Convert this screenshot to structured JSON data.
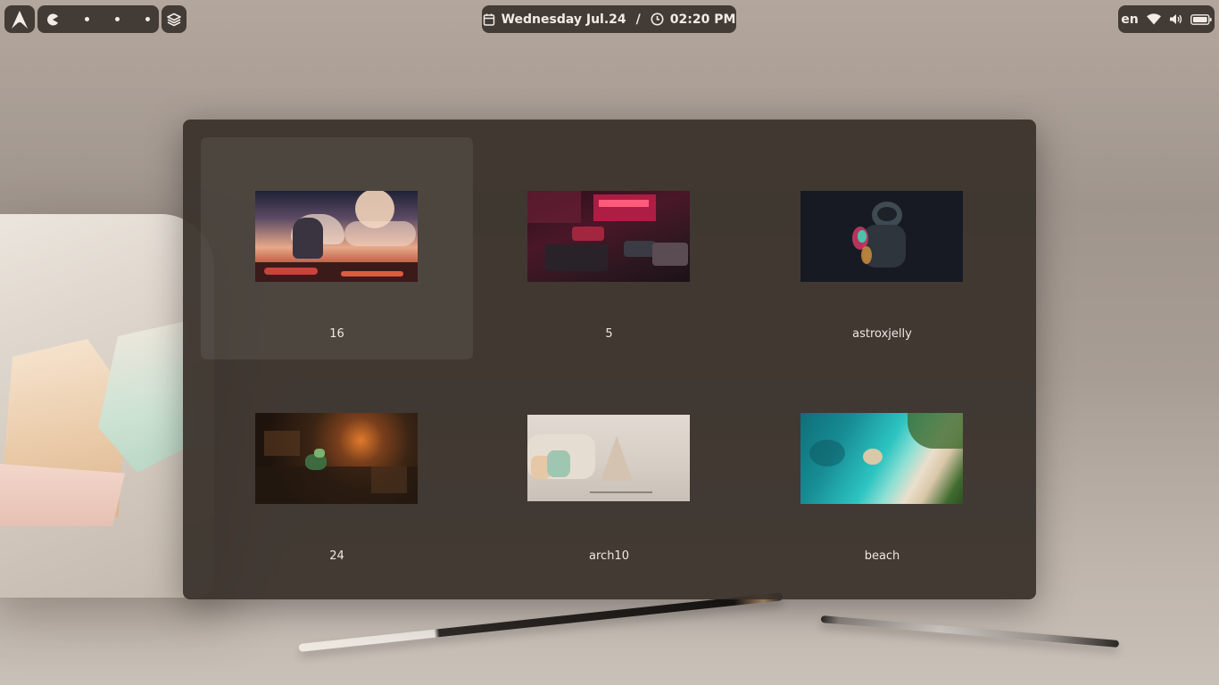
{
  "topbar": {
    "launcher_icon": "arch-logo-icon",
    "workspaces": [
      {
        "icon": "pacman-icon",
        "active": true
      },
      {
        "icon": "dot-icon",
        "active": false
      },
      {
        "icon": "dot-icon",
        "active": false
      },
      {
        "icon": "dot-icon",
        "active": false
      }
    ],
    "layers_icon": "layers-icon",
    "date": "Wednesday Jul.24",
    "separator": "/",
    "time": "02:20 PM",
    "language": "en",
    "tray_icons": [
      "wifi-icon",
      "volume-icon",
      "battery-icon"
    ]
  },
  "wallpaper_picker": {
    "selected_index": 0,
    "items": [
      {
        "name": "16",
        "palette": [
          "#1f2236",
          "#e7a88a",
          "#f0d2b8",
          "#c9433b"
        ]
      },
      {
        "name": "5",
        "palette": [
          "#2a0f1a",
          "#c01f4a",
          "#ff5a7a",
          "#3a3b45"
        ]
      },
      {
        "name": "astroxjelly",
        "palette": [
          "#171a22",
          "#3f4a52",
          "#d23a66",
          "#3bd6b8"
        ]
      },
      {
        "name": "24",
        "palette": [
          "#1f140d",
          "#5a3a22",
          "#e07a2c",
          "#3d6b3f"
        ]
      },
      {
        "name": "arch10",
        "palette": [
          "#d8d0c8",
          "#bdb3a8",
          "#9fc6b1",
          "#e6c8a6"
        ]
      },
      {
        "name": "beach",
        "palette": [
          "#0f6e78",
          "#2cc4c1",
          "#eadfcc",
          "#3f6b2f"
        ]
      }
    ]
  }
}
